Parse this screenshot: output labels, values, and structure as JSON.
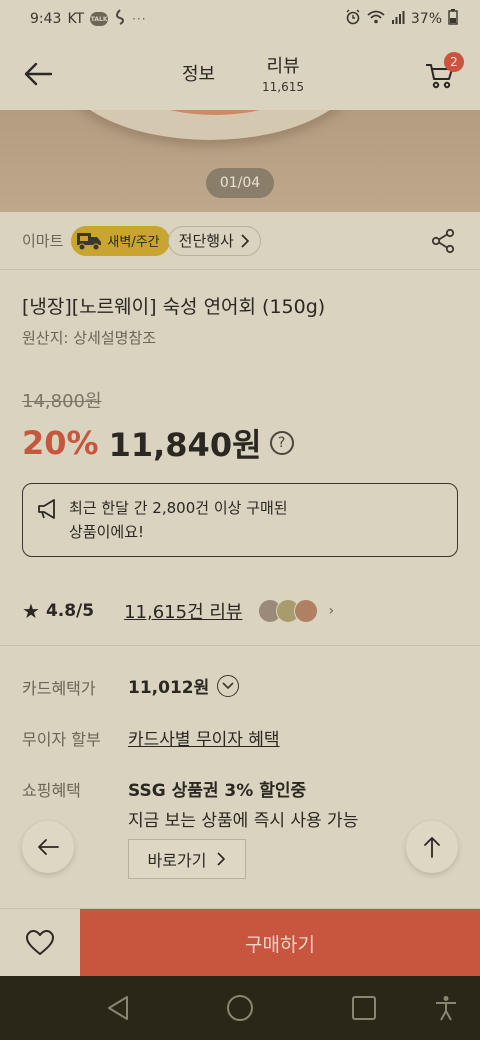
{
  "status_bar": {
    "time": "9:43",
    "carrier": "KT",
    "talk_label": "TALK",
    "battery": "37%"
  },
  "header": {
    "tab_info": "정보",
    "tab_review": "리뷰",
    "review_count": "11,615",
    "cart_count": "2"
  },
  "gallery": {
    "page_indicator": "01/04"
  },
  "brand_row": {
    "brand": "이마트",
    "delivery_badge": "새벽/주간",
    "event_chip": "전단행사"
  },
  "product": {
    "title": "[냉장][노르웨이] 숙성 연어회 (150g)",
    "origin": "원산지: 상세설명참조",
    "original_price": "14,800원",
    "discount": "20%",
    "sale_price": "11,840원"
  },
  "notice": {
    "text_line1": "최근 한달 간 2,800건 이상 구매된",
    "text_line2": "상품이에요!"
  },
  "rating": {
    "star": "★",
    "score": "4.8/5",
    "review_link": "11,615건 리뷰"
  },
  "benefits": {
    "card_label": "카드혜택가",
    "card_price": "11,012원",
    "installment_label": "무이자 할부",
    "installment_value": "카드사별 무이자 혜택",
    "shopping_label": "쇼핑혜택",
    "shopping_title": "SSG 상품권 3% 할인중",
    "shopping_desc": "지금 보는 상품에 즉시 사용 가능",
    "goto_button": "바로가기"
  },
  "bottom_bar": {
    "buy_button": "구매하기"
  },
  "colors": {
    "accent": "#c8553d",
    "badge_yellow": "#c9a431",
    "background": "#d9d3bf",
    "navbar": "#2a2719"
  }
}
